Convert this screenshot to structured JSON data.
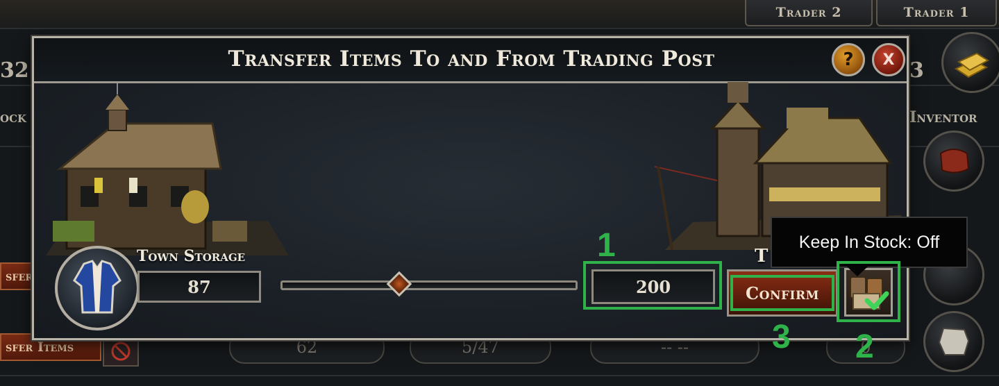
{
  "background": {
    "tabs": [
      "Trader 2",
      "Trader 1"
    ],
    "left_value": "32",
    "left_label": "ock",
    "right_value": "3",
    "right_label": "Inventor",
    "left_button_1": "sfer",
    "left_button_2": "sfer Items",
    "row_values": [
      "62",
      "5/47",
      "-- --",
      "0"
    ]
  },
  "dialog": {
    "title": "Transfer Items To and From Trading Post",
    "help_label": "?",
    "close_label": "X",
    "town_storage_label": "Town Storage",
    "town_storage_value": "87",
    "transfer_amount": "200",
    "trading_post_label_partial": "T",
    "confirm_label": "Confirm",
    "keep_in_stock_tooltip": "Keep In Stock: Off",
    "slider_level": 0.42
  },
  "annotations": {
    "callouts": [
      "1",
      "2",
      "3"
    ],
    "color": "#2fb24a"
  },
  "icons": [
    "help-icon",
    "close-icon",
    "jacket-icon",
    "crates-icon",
    "checkmark-icon",
    "gold-bars-icon",
    "leather-icon",
    "pelt-icon"
  ]
}
